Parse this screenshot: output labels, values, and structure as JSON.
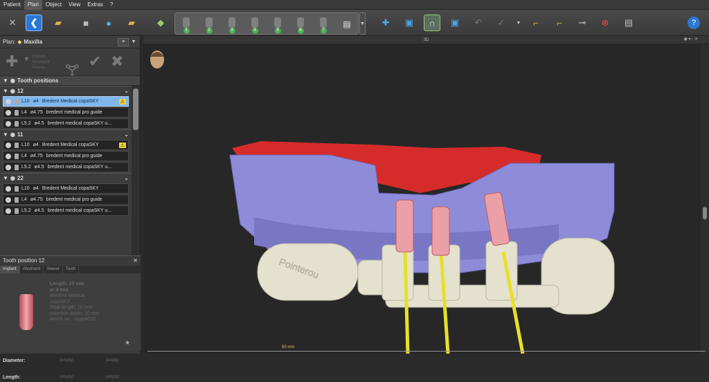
{
  "menubar": {
    "items": [
      "Patient",
      "Plan",
      "Object",
      "View",
      "Extras",
      "?"
    ],
    "active": "Plan"
  },
  "toolbar": {
    "tooth_numbers": [
      "1",
      "2",
      "3",
      "4",
      "5",
      "6",
      "7"
    ]
  },
  "plan": {
    "label": "Plan:",
    "value": "Maxilla"
  },
  "plan_tools": {
    "labels": [
      "Implant",
      "Abutment",
      "Sleeve"
    ]
  },
  "tooth_positions": {
    "title": "Tooth positions",
    "groups": [
      {
        "name": "12",
        "rows": [
          {
            "length": "10",
            "diameter": "4",
            "product": "Bredent Medical copaSKY",
            "warning": true
          },
          {
            "length": "4",
            "diameter": "4.75",
            "product": "bredent medical pro guide",
            "warning": false
          },
          {
            "length": "5.2",
            "diameter": "4.5",
            "product": "bredent medical copaSKY u...",
            "warning": false
          }
        ]
      },
      {
        "name": "11",
        "rows": [
          {
            "length": "10",
            "diameter": "4",
            "product": "Bredent Medical copaSKY",
            "warning": true
          },
          {
            "length": "4",
            "diameter": "4.75",
            "product": "bredent medical pro guide",
            "warning": false
          },
          {
            "length": "5.2",
            "diameter": "4.5",
            "product": "bredent medical copaSKY u...",
            "warning": false
          }
        ]
      },
      {
        "name": "22",
        "rows": [
          {
            "length": "10",
            "diameter": "4",
            "product": "Bredent Medical copaSKY",
            "warning": false
          },
          {
            "length": "4",
            "diameter": "4.75",
            "product": "bredent medical pro guide",
            "warning": false
          },
          {
            "length": "5.2",
            "diameter": "4.5",
            "product": "bredent medical copaSKY u...",
            "warning": false
          }
        ]
      }
    ]
  },
  "tooth_position_detail": {
    "title": "Tooth position 12",
    "tabs": [
      "Implant",
      "Abutment",
      "Sleeve",
      "Tooth"
    ],
    "specs": {
      "length": "Length: 10 mm",
      "diameter": "ø: 4 mm",
      "manufacturer": "Bredent Medical",
      "product": "copaSKY",
      "total_length": "Total length: 10 mm",
      "insertion_depth": "Insertion depth: 10 mm",
      "article": "Article no.: copa4010"
    },
    "diameter_label": "Diameter:",
    "length_label": "Length:",
    "empty": "(empty)"
  },
  "viewport": {
    "title": "3D",
    "scale_label": "50 mm",
    "watermark": "Pointerou"
  }
}
